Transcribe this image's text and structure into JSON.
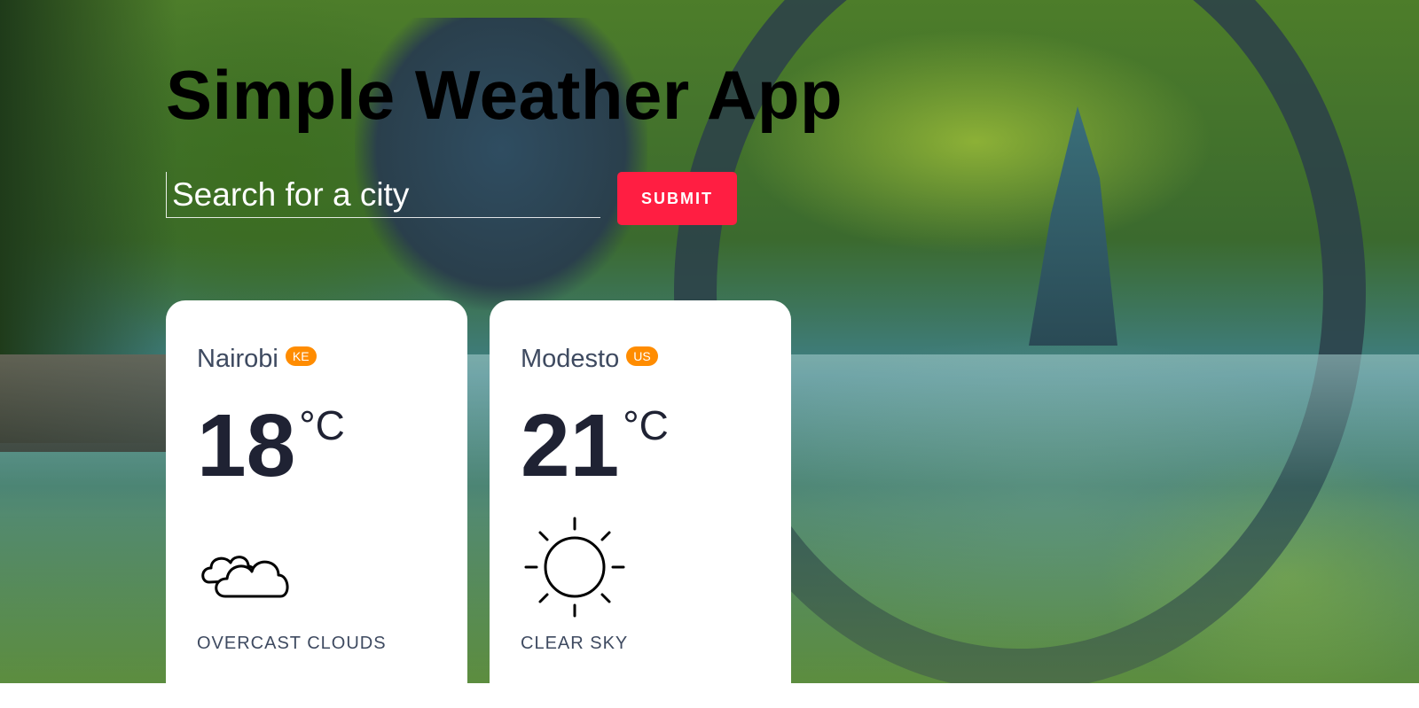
{
  "app": {
    "title": "Simple Weather App"
  },
  "search": {
    "placeholder": "Search for a city",
    "value": "",
    "submit_label": "SUBMIT"
  },
  "colors": {
    "submit_button": "#ff1e42",
    "country_badge": "#ff8c00",
    "card_background": "#ffffff"
  },
  "cards": [
    {
      "city": "Nairobi",
      "country": "KE",
      "temperature": "18",
      "unit": "°C",
      "icon": "cloud-icon",
      "description": "OVERCAST CLOUDS"
    },
    {
      "city": "Modesto",
      "country": "US",
      "temperature": "21",
      "unit": "°C",
      "icon": "sun-icon",
      "description": "CLEAR SKY"
    }
  ]
}
